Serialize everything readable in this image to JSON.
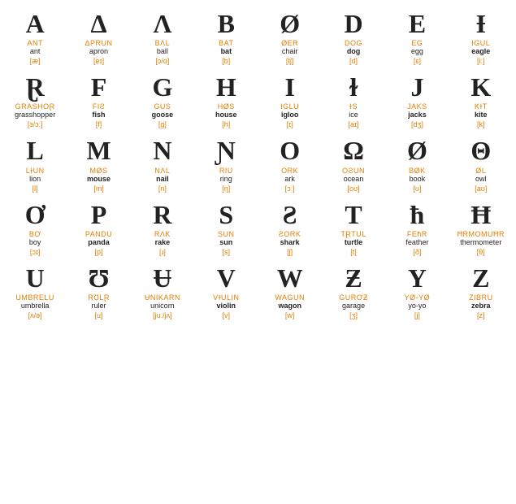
{
  "rows": [
    {
      "cells": [
        {
          "big": "A",
          "upper": "ANT",
          "lower": "ant",
          "phonetic": "[æ]",
          "bold": false
        },
        {
          "big": "Δ",
          "upper": "ΔPRUN",
          "lower": "apron",
          "phonetic": "[eɪ]",
          "bold": false
        },
        {
          "big": "Λ",
          "upper": "BΛL",
          "lower": "ball",
          "phonetic": "[ɔ/ɑ]",
          "bold": false
        },
        {
          "big": "B",
          "upper": "BAT",
          "lower": "bat",
          "phonetic": "[b]",
          "bold": true
        },
        {
          "big": "Ø",
          "upper": "ØER",
          "lower": "chair",
          "phonetic": "[tʃ]",
          "bold": false
        },
        {
          "big": "D",
          "upper": "DOG",
          "lower": "dog",
          "phonetic": "[d]",
          "bold": true
        },
        {
          "big": "E",
          "upper": "EG",
          "lower": "egg",
          "phonetic": "[ɛ]",
          "bold": false
        },
        {
          "big": "Ɨ",
          "upper": "ƗGUL",
          "lower": "eagle",
          "phonetic": "[iː]",
          "bold": true
        }
      ]
    },
    {
      "cells": [
        {
          "big": "Ɽ",
          "upper": "GRASHOⱤ",
          "lower": "grasshopper",
          "phonetic": "[ɜ/ɔː]",
          "bold": false
        },
        {
          "big": "F",
          "upper": "FIƧ",
          "lower": "fish",
          "phonetic": "[f]",
          "bold": true
        },
        {
          "big": "G",
          "upper": "GUS",
          "lower": "goose",
          "phonetic": "[g]",
          "bold": true
        },
        {
          "big": "H",
          "upper": "HØS",
          "lower": "house",
          "phonetic": "[h]",
          "bold": true
        },
        {
          "big": "I",
          "upper": "IGLU",
          "lower": "igloo",
          "phonetic": "[ɪ]",
          "bold": true
        },
        {
          "big": "ɫ",
          "upper": "ɫS",
          "lower": "ice",
          "phonetic": "[aɪ]",
          "bold": false
        },
        {
          "big": "J",
          "upper": "JAKS",
          "lower": "jacks",
          "phonetic": "[dʒ]",
          "bold": true
        },
        {
          "big": "K",
          "upper": "KɫT",
          "lower": "kite",
          "phonetic": "[k]",
          "bold": true
        }
      ]
    },
    {
      "cells": [
        {
          "big": "L",
          "upper": "LɫUN",
          "lower": "lion",
          "phonetic": "[l]",
          "bold": false
        },
        {
          "big": "M",
          "upper": "MØS",
          "lower": "mouse",
          "phonetic": "[m]",
          "bold": true
        },
        {
          "big": "N",
          "upper": "NΛL",
          "lower": "nail",
          "phonetic": "[n]",
          "bold": true
        },
        {
          "big": "Ɲ",
          "upper": "RIƲ",
          "lower": "ring",
          "phonetic": "[ŋ]",
          "bold": false
        },
        {
          "big": "O",
          "upper": "ORK",
          "lower": "ark",
          "phonetic": "[ɔː]",
          "bold": false
        },
        {
          "big": "Ω",
          "upper": "OƧUN",
          "lower": "ocean",
          "phonetic": "[oʊ]",
          "bold": false
        },
        {
          "big": "Ø",
          "upper": "BØK",
          "lower": "book",
          "phonetic": "[ʊ]",
          "bold": false
        },
        {
          "big": "Θ",
          "upper": "ØL",
          "lower": "owl",
          "phonetic": "[aʊ]",
          "bold": false
        }
      ]
    },
    {
      "cells": [
        {
          "big": "Ơ",
          "upper": "BƠ",
          "lower": "boy",
          "phonetic": "[ɔɪ]",
          "bold": false
        },
        {
          "big": "P",
          "upper": "PANDU",
          "lower": "panda",
          "phonetic": "[p]",
          "bold": true
        },
        {
          "big": "R",
          "upper": "RΛK",
          "lower": "rake",
          "phonetic": "[ɹ]",
          "bold": true
        },
        {
          "big": "S",
          "upper": "SUN",
          "lower": "sun",
          "phonetic": "[s]",
          "bold": true
        },
        {
          "big": "Ƨ",
          "upper": "ƧORK",
          "lower": "shark",
          "phonetic": "[ʃ]",
          "bold": true
        },
        {
          "big": "T",
          "upper": "TⱤTUL",
          "lower": "turtle",
          "phonetic": "[t]",
          "bold": true
        },
        {
          "big": "ħ",
          "upper": "FEħR",
          "lower": "feather",
          "phonetic": "[ð]",
          "bold": false
        },
        {
          "big": "Ħ",
          "upper": "ĦRMOMUĦR",
          "lower": "thermometer",
          "phonetic": "[θ]",
          "bold": false
        }
      ]
    },
    {
      "cells": [
        {
          "big": "U",
          "upper": "UMBRELU",
          "lower": "umbrella",
          "phonetic": "[ʌ/ə]",
          "bold": false
        },
        {
          "big": "Ʊ",
          "upper": "RƱLⱤ",
          "lower": "ruler",
          "phonetic": "[u]",
          "bold": false
        },
        {
          "big": "Ʉ",
          "upper": "ɄNIKARN",
          "lower": "unicorn",
          "phonetic": "[juː/jʌ]",
          "bold": false
        },
        {
          "big": "V",
          "upper": "VɫULIN",
          "lower": "violin",
          "phonetic": "[v]",
          "bold": true
        },
        {
          "big": "W",
          "upper": "WAGUN",
          "lower": "wagon",
          "phonetic": "[w]",
          "bold": true
        },
        {
          "big": "Ƶ",
          "upper": "GURƠƵ",
          "lower": "garage",
          "phonetic": "[ʒ]",
          "bold": false
        },
        {
          "big": "Y",
          "upper": "YØ-YØ",
          "lower": "yo-yo",
          "phonetic": "[j]",
          "bold": false
        },
        {
          "big": "Z",
          "upper": "ZIBRU",
          "lower": "zebra",
          "phonetic": "[z]",
          "bold": true
        }
      ]
    }
  ]
}
